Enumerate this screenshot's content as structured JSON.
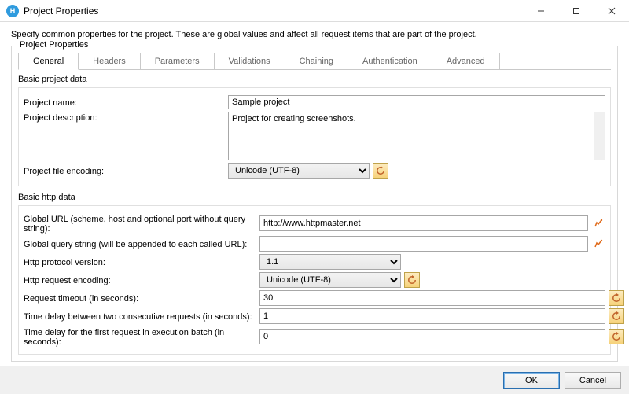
{
  "window": {
    "title": "Project Properties",
    "description": "Specify common properties for the project. These are global values and affect all request items that are part of the project."
  },
  "groupbox": {
    "legend": "Project Properties"
  },
  "tabs": [
    {
      "label": "General",
      "active": true
    },
    {
      "label": "Headers"
    },
    {
      "label": "Parameters"
    },
    {
      "label": "Validations"
    },
    {
      "label": "Chaining"
    },
    {
      "label": "Authentication"
    },
    {
      "label": "Advanced"
    }
  ],
  "basic_project": {
    "legend": "Basic project data",
    "name_label": "Project name:",
    "name_value": "Sample project",
    "desc_label": "Project description:",
    "desc_value": "Project for creating screenshots.",
    "encoding_label": "Project file encoding:",
    "encoding_value": "Unicode (UTF-8)"
  },
  "basic_http": {
    "legend": "Basic http data",
    "url_label": "Global URL (scheme, host and optional port without query string):",
    "url_value": "http://www.httpmaster.net",
    "query_label": "Global query string (will be appended to each called URL):",
    "query_value": "",
    "version_label": "Http protocol version:",
    "version_value": "1.1",
    "req_encoding_label": "Http request encoding:",
    "req_encoding_value": "Unicode (UTF-8)",
    "timeout_label": "Request timeout (in seconds):",
    "timeout_value": "30",
    "delay_between_label": "Time delay between two consecutive requests (in seconds):",
    "delay_between_value": "1",
    "delay_first_label": "Time delay for the first request in execution batch (in seconds):",
    "delay_first_value": "0"
  },
  "footer": {
    "ok": "OK",
    "cancel": "Cancel"
  }
}
